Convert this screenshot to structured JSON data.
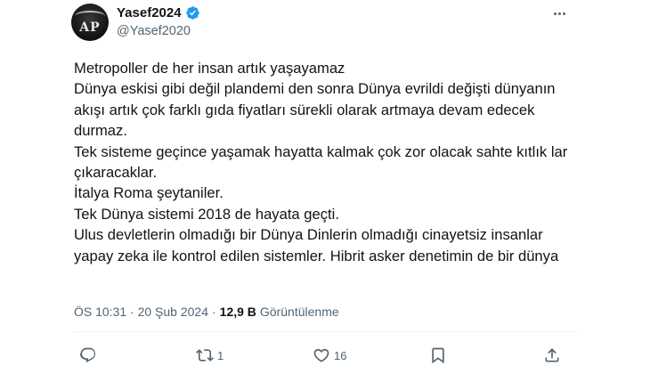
{
  "author": {
    "display_name": "Yasef2024",
    "handle": "@Yasef2020",
    "avatar_text": "AP",
    "verified_icon": "verified-badge-icon",
    "verified_color": "#1d9bf0"
  },
  "tweet": {
    "text": "Metropoller de her insan artık yaşayamaz\nDünya eskisi gibi değil plandemi den sonra Dünya evrildi değişti dünyanın akışı artık çok farklı gıda fiyatları sürekli olarak artmaya devam edecek durmaz.\nTek sisteme geçince yaşamak hayatta kalmak çok zor olacak sahte kıtlık lar çıkaracaklar.\nİtalya Roma şeytaniler.\nTek Dünya sistemi 2018 de hayata geçti.\nUlus devletlerin olmadığı bir Dünya Dinlerin olmadığı cinayetsiz insanlar yapay zeka ile kontrol edilen sistemler. Hibrit asker denetimin de bir dünya"
  },
  "meta": {
    "timestamp": "ÖS 10:31 · 20 Şub 2024",
    "separator": "·",
    "views_count": "12,9 B",
    "views_label": "Görüntülenme"
  },
  "actions": {
    "reply_count": "",
    "retweet_count": "1",
    "like_count": "16",
    "icon_color": "#536471"
  }
}
